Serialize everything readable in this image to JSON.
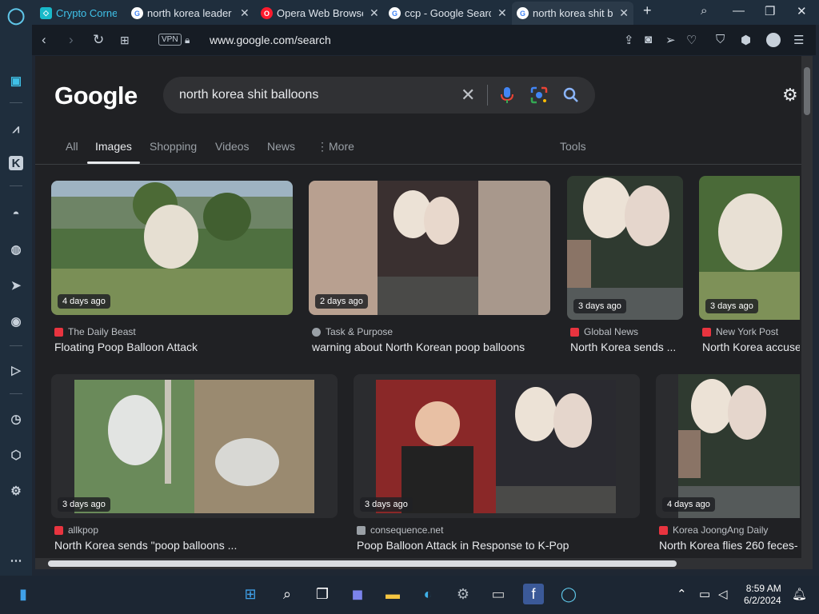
{
  "tabs": [
    {
      "title": "Crypto Corne",
      "active": false
    },
    {
      "title": "north korea leader",
      "active": false
    },
    {
      "title": "Opera Web Browse",
      "active": false
    },
    {
      "title": "ccp - Google Search",
      "active": false
    },
    {
      "title": "north korea shit b",
      "active": true
    }
  ],
  "addressbar": {
    "vpn": "VPN",
    "url": "www.google.com/search"
  },
  "search": {
    "query": "north korea shit balloons",
    "logo": "Google"
  },
  "nav": {
    "all": "All",
    "images": "Images",
    "shopping": "Shopping",
    "videos": "Videos",
    "news": "News",
    "more": "More",
    "tools": "Tools"
  },
  "results": [
    {
      "age": "4 days ago",
      "source": "The Daily Beast",
      "caption": "Floating Poop Balloon Attack",
      "fav": "#e8343f"
    },
    {
      "age": "2 days ago",
      "source": "Task & Purpose",
      "caption": "warning about North Korean poop balloons",
      "fav": "#9aa0a6"
    },
    {
      "age": "3 days ago",
      "source": "Global News",
      "caption": "North Korea sends ...",
      "fav": "#e8343f"
    },
    {
      "age": "3 days ago",
      "source": "New York Post",
      "caption": "North Korea accuse",
      "fav": "#e8343f"
    },
    {
      "age": "3 days ago",
      "source": "allkpop",
      "caption": "North Korea sends \"poop balloons ...",
      "fav": "#e8343f"
    },
    {
      "age": "3 days ago",
      "source": "consequence.net",
      "caption": "Poop Balloon Attack in Response to K-Pop",
      "fav": "#9aa0a6"
    },
    {
      "age": "4 days ago",
      "source": "Korea JoongAng Daily",
      "caption": "North Korea flies 260 feces-",
      "fav": "#e8343f"
    }
  ],
  "clock": {
    "time": "8:59 AM",
    "date": "6/2/2024"
  }
}
